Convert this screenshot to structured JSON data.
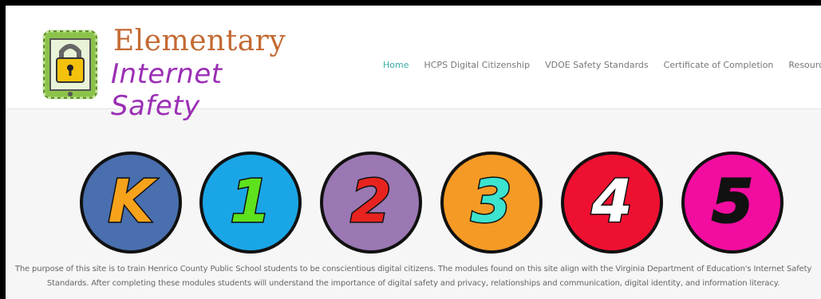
{
  "logo": {
    "title": "Elementary",
    "subtitle": "Internet Safety",
    "icon": "padlock-tablet-icon"
  },
  "nav": {
    "items": [
      {
        "label": "Home",
        "active": true
      },
      {
        "label": "HCPS Digital Citizenship",
        "active": false
      },
      {
        "label": "VDOE Safety Standards",
        "active": false
      },
      {
        "label": "Certificate of Completion",
        "active": false
      },
      {
        "label": "Resources",
        "active": false
      }
    ],
    "search_icon": "search-icon"
  },
  "grades": [
    {
      "label": "K",
      "bg": "#4a6fae",
      "fg": "#f7a21b"
    },
    {
      "label": "1",
      "bg": "#1aa6e6",
      "fg": "#5de21d"
    },
    {
      "label": "2",
      "bg": "#9b78b3",
      "fg": "#e8231f"
    },
    {
      "label": "3",
      "bg": "#f59a25",
      "fg": "#3ce3cf"
    },
    {
      "label": "4",
      "bg": "#ee1031",
      "fg": "#ffffff"
    },
    {
      "label": "5",
      "bg": "#f20da0",
      "fg": "#111111"
    }
  ],
  "description": {
    "line1": "The purpose of this site is to train Henrico County Public School students to be conscientious digital citizens. The modules found on this site align with the Virginia Department of Education's Internet Safety",
    "line2": "Standards. After completing these modules students will understand the importance of digital safety and privacy, relationships and communication, digital identity, and information literacy."
  },
  "colors": {
    "nav_active": "#3aa9a6",
    "logo_title": "#c46a33",
    "logo_subtitle": "#9b2fb5"
  }
}
